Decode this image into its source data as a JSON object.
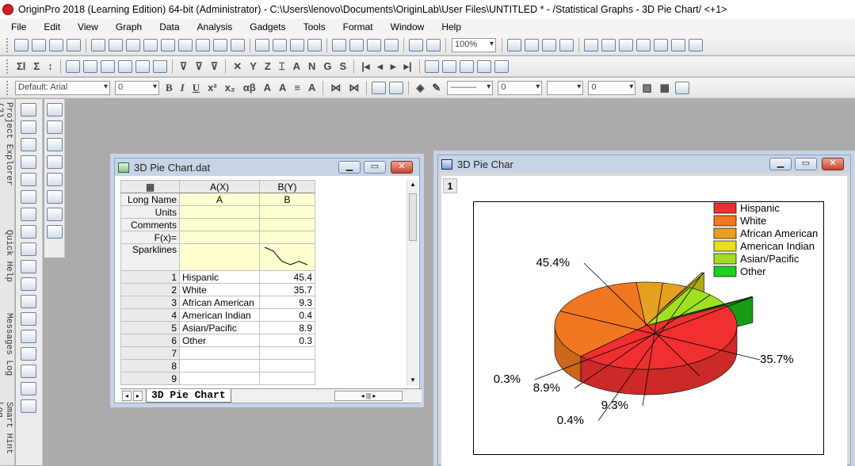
{
  "app_title": "OriginPro 2018 (Learning Edition) 64-bit (Administrator) - C:\\Users\\lenovo\\Documents\\OriginLab\\User Files\\UNTITLED * - /Statistical Graphs - 3D Pie Chart/ <+1>",
  "menu": [
    "File",
    "Edit",
    "View",
    "Graph",
    "Data",
    "Analysis",
    "Gadgets",
    "Tools",
    "Format",
    "Window",
    "Help"
  ],
  "toolbar": {
    "zoom": "100%",
    "font": "Default: Arial",
    "font_size": "0",
    "bold": "B",
    "italic": "I",
    "underline": "U",
    "line_width": "0",
    "size_value": "0"
  },
  "left_dock": [
    "Project Explorer (2)",
    "Quick Help",
    "Messages Log",
    "Smart Hint Log"
  ],
  "worksheet": {
    "title": "3D Pie Chart.dat",
    "col_headers": [
      "A(X)",
      "B(Y)"
    ],
    "header_rows": [
      {
        "label": "Long Name",
        "a": "A",
        "b": "B"
      },
      {
        "label": "Units",
        "a": "",
        "b": ""
      },
      {
        "label": "Comments",
        "a": "",
        "b": ""
      },
      {
        "label": "F(x)=",
        "a": "",
        "b": ""
      },
      {
        "label": "Sparklines",
        "a": "",
        "b": ""
      }
    ],
    "rows": [
      {
        "n": "1",
        "a": "Hispanic",
        "b": "45.4"
      },
      {
        "n": "2",
        "a": "White",
        "b": "35.7"
      },
      {
        "n": "3",
        "a": "African American",
        "b": "9.3"
      },
      {
        "n": "4",
        "a": "American Indian",
        "b": "0.4"
      },
      {
        "n": "5",
        "a": "Asian/Pacific",
        "b": "8.9"
      },
      {
        "n": "6",
        "a": "Other",
        "b": "0.3"
      },
      {
        "n": "7",
        "a": "",
        "b": ""
      },
      {
        "n": "8",
        "a": "",
        "b": ""
      },
      {
        "n": "9",
        "a": "",
        "b": ""
      }
    ],
    "sheet_tab": "3D Pie Chart"
  },
  "graph": {
    "title": "3D Pie Char",
    "layer": "1",
    "chart_data": {
      "type": "pie",
      "categories": [
        "Hispanic",
        "White",
        "African American",
        "American Indian",
        "Asian/Pacific",
        "Other"
      ],
      "values": [
        45.4,
        35.7,
        9.3,
        0.4,
        8.9,
        0.3
      ],
      "labels": [
        "45.4%",
        "35.7%",
        "9.3%",
        "0.4%",
        "8.9%",
        "0.3%"
      ],
      "colors": [
        "#f03030",
        "#f07820",
        "#e6a020",
        "#e6e020",
        "#a0e020",
        "#20d020"
      ],
      "legend_position": "top-right",
      "style": "3d"
    }
  }
}
